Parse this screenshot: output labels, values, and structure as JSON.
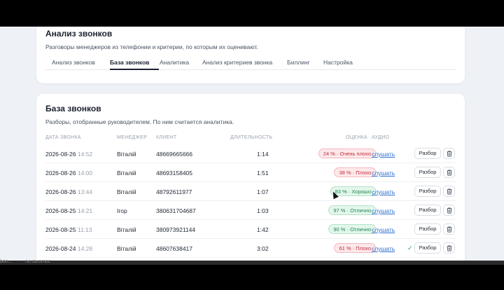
{
  "header": {
    "title": "Анализ звонков",
    "subtitle": "Разговоры менеджеров из телефонии и критерии, по которым их оценивают."
  },
  "tabs": [
    {
      "label": "Анализ звонков"
    },
    {
      "label": "База звонков"
    },
    {
      "label": "Аналитика"
    },
    {
      "label": "Анализ критериев звонка"
    },
    {
      "label": "Биллинг"
    },
    {
      "label": "Настройка"
    }
  ],
  "calls": {
    "title": "База звонков",
    "subtitle": "Разборы, отобранные руководителем. По ним считается аналитика.",
    "columns": {
      "date": "ДАТА ЗВОНКА",
      "manager": "МЕНЕДЖЕР",
      "client": "КЛИЕНТ",
      "duration": "ДЛИТЕЛЬНОСТЬ",
      "score": "ОЦЕНКА",
      "audio": "АУДИО"
    },
    "listen_label": "слушать",
    "review_label": "Разбор",
    "delete_icon": "trash-icon",
    "check_icon": "check-icon",
    "rows": [
      {
        "date": "2026-08-26",
        "time": "14:52",
        "manager": "Віталій",
        "client": "48669665666",
        "duration": "1:14",
        "score": "24 % · Очень плохо",
        "tone": "red",
        "checked": false
      },
      {
        "date": "2026-08-26",
        "time": "14:00",
        "manager": "Віталій",
        "client": "48693158405",
        "duration": "1:51",
        "score": "38 % · Плохо",
        "tone": "red",
        "checked": false
      },
      {
        "date": "2026-08-26",
        "time": "13:44",
        "manager": "Віталій",
        "client": "48792611977",
        "duration": "1:07",
        "score": "83 % · Хорошо",
        "tone": "green",
        "checked": false
      },
      {
        "date": "2026-08-25",
        "time": "14:21",
        "manager": "Ігор",
        "client": "380631704687",
        "duration": "1:03",
        "score": "97 % · Отлично",
        "tone": "green",
        "checked": false
      },
      {
        "date": "2026-08-25",
        "time": "11:13",
        "manager": "Віталій",
        "client": "380973921144",
        "duration": "1:42",
        "score": "90 % · Отлично",
        "tone": "green",
        "checked": false
      },
      {
        "date": "2026-08-24",
        "time": "14:28",
        "manager": "Віталій",
        "client": "48607638417",
        "duration": "3:02",
        "score": "61 % · Плохо",
        "tone": "red",
        "checked": true
      }
    ]
  },
  "colors": {
    "accent_link": "#2d6fcf",
    "bad": "#c0303f",
    "good": "#1c8a4c",
    "background": "#eef1f6"
  },
  "taskbar": {
    "left_text": "bon...",
    "mid_text": "ne.sa.omoc"
  }
}
